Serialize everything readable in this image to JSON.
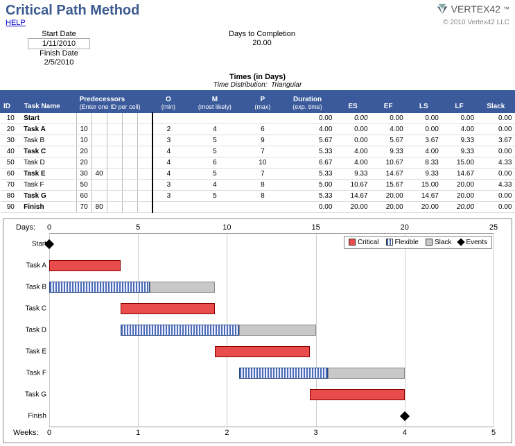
{
  "header": {
    "title": "Critical Path Method",
    "help": "HELP",
    "brand": "VERTEX42",
    "tm": "™",
    "copyright": "© 2010 Vertex42 LLC"
  },
  "info": {
    "start_date_label": "Start Date",
    "start_date": "1/11/2010",
    "finish_date_label": "Finish Date",
    "finish_date": "2/5/2010",
    "days_comp_label": "Days to Completion",
    "days_comp": "20.00"
  },
  "times": {
    "title": "Times (in Days)",
    "dist_label": "Time Distribution:",
    "dist_value": "Triangular"
  },
  "columns": {
    "id": "ID",
    "task": "Task Name",
    "pred": "Predecessors",
    "pred_sub": "(Enter one ID per cell)",
    "o": "O",
    "o_sub": "(min)",
    "m": "M",
    "m_sub": "(most likely)",
    "p": "P",
    "p_sub": "(max)",
    "dur": "Duration",
    "dur_sub": "(exp. time)",
    "es": "ES",
    "ef": "EF",
    "ls": "LS",
    "lf": "LF",
    "slack": "Slack"
  },
  "rows": [
    {
      "id": "10",
      "name": "Start",
      "bold": true,
      "pred": [
        "",
        "",
        "",
        "",
        ""
      ],
      "o": "",
      "m": "",
      "p": "",
      "dur": "0.00",
      "es": "0.00",
      "es_i": true,
      "ef": "0.00",
      "ls": "0.00",
      "lf": "0.00",
      "slack": "0.00"
    },
    {
      "id": "20",
      "name": "Task A",
      "bold": true,
      "pred": [
        "10",
        "",
        "",
        "",
        ""
      ],
      "o": "2",
      "m": "4",
      "p": "6",
      "dur": "4.00",
      "es": "0.00",
      "ef": "4.00",
      "ls": "0.00",
      "lf": "4.00",
      "slack": "0.00"
    },
    {
      "id": "30",
      "name": "Task B",
      "bold": false,
      "pred": [
        "10",
        "",
        "",
        "",
        ""
      ],
      "o": "3",
      "m": "5",
      "p": "9",
      "dur": "5.67",
      "es": "0.00",
      "ef": "5.67",
      "ls": "3.67",
      "lf": "9.33",
      "slack": "3.67"
    },
    {
      "id": "40",
      "name": "Task C",
      "bold": true,
      "pred": [
        "20",
        "",
        "",
        "",
        ""
      ],
      "o": "4",
      "m": "5",
      "p": "7",
      "dur": "5.33",
      "es": "4.00",
      "ef": "9.33",
      "ls": "4.00",
      "lf": "9.33",
      "slack": "0.00"
    },
    {
      "id": "50",
      "name": "Task D",
      "bold": false,
      "pred": [
        "20",
        "",
        "",
        "",
        ""
      ],
      "o": "4",
      "m": "6",
      "p": "10",
      "dur": "6.67",
      "es": "4.00",
      "ef": "10.67",
      "ls": "8.33",
      "lf": "15.00",
      "slack": "4.33"
    },
    {
      "id": "60",
      "name": "Task E",
      "bold": true,
      "pred": [
        "30",
        "40",
        "",
        "",
        ""
      ],
      "o": "4",
      "m": "5",
      "p": "7",
      "dur": "5.33",
      "es": "9.33",
      "ef": "14.67",
      "ls": "9.33",
      "lf": "14.67",
      "slack": "0.00"
    },
    {
      "id": "70",
      "name": "Task F",
      "bold": false,
      "pred": [
        "50",
        "",
        "",
        "",
        ""
      ],
      "o": "3",
      "m": "4",
      "p": "8",
      "dur": "5.00",
      "es": "10.67",
      "ef": "15.67",
      "ls": "15.00",
      "lf": "20.00",
      "slack": "4.33"
    },
    {
      "id": "80",
      "name": "Task G",
      "bold": true,
      "pred": [
        "60",
        "",
        "",
        "",
        ""
      ],
      "o": "3",
      "m": "5",
      "p": "8",
      "dur": "5.33",
      "es": "14.67",
      "ef": "20.00",
      "ls": "14.67",
      "lf": "20.00",
      "slack": "0.00"
    },
    {
      "id": "90",
      "name": "Finish",
      "bold": true,
      "pred": [
        "70",
        "80",
        "",
        "",
        ""
      ],
      "o": "",
      "m": "",
      "p": "",
      "dur": "0.00",
      "es": "20.00",
      "ef": "20.00",
      "ls": "20.00",
      "lf": "20.00",
      "lf_i": true,
      "slack": "0.00"
    }
  ],
  "legend": {
    "critical": "Critical",
    "flexible": "Flexible",
    "slack": "Slack",
    "events": "Events"
  },
  "chart": {
    "days_label": "Days:",
    "weeks_label": "Weeks:",
    "x_max": 25,
    "days_ticks": [
      0,
      5,
      10,
      15,
      20,
      25
    ],
    "weeks_ticks": [
      0,
      1,
      2,
      3,
      4,
      5
    ]
  },
  "chart_data": {
    "type": "gantt",
    "x_unit": "days",
    "x_range": [
      0,
      25
    ],
    "series": [
      {
        "name": "Start",
        "kind": "event",
        "at": 0
      },
      {
        "name": "Task A",
        "kind": "critical",
        "es": 0,
        "ef": 4,
        "lf": 4
      },
      {
        "name": "Task B",
        "kind": "flexible",
        "es": 0,
        "ef": 5.67,
        "lf": 9.33
      },
      {
        "name": "Task C",
        "kind": "critical",
        "es": 4,
        "ef": 9.33,
        "lf": 9.33
      },
      {
        "name": "Task D",
        "kind": "flexible",
        "es": 4,
        "ef": 10.67,
        "lf": 15
      },
      {
        "name": "Task E",
        "kind": "critical",
        "es": 9.33,
        "ef": 14.67,
        "lf": 14.67
      },
      {
        "name": "Task F",
        "kind": "flexible",
        "es": 10.67,
        "ef": 15.67,
        "lf": 20
      },
      {
        "name": "Task G",
        "kind": "critical",
        "es": 14.67,
        "ef": 20,
        "lf": 20
      },
      {
        "name": "Finish",
        "kind": "event",
        "at": 20
      }
    ]
  }
}
